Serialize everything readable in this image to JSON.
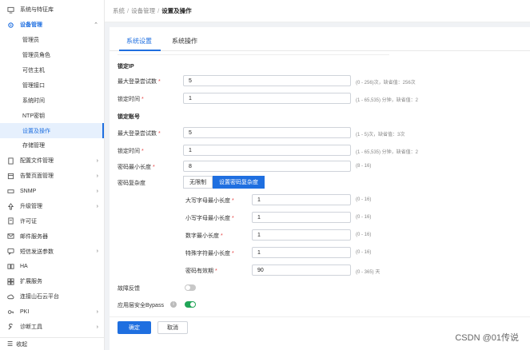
{
  "breadcrumb": [
    "系统",
    "设备管理",
    "设置及操作"
  ],
  "sidebar": {
    "items": [
      {
        "label": "系统与特征库",
        "icon": "monitor-icon"
      },
      {
        "label": "设备管理",
        "icon": "gear-icon"
      },
      {
        "label": "管理员"
      },
      {
        "label": "管理员角色"
      },
      {
        "label": "可信主机"
      },
      {
        "label": "管理接口"
      },
      {
        "label": "系统时间"
      },
      {
        "label": "NTP密钥"
      },
      {
        "label": "设置及操作"
      },
      {
        "label": "存储管理"
      },
      {
        "label": "配置文件管理",
        "icon": "file-icon"
      },
      {
        "label": "告警页面管理",
        "icon": "alarm-page-icon"
      },
      {
        "label": "SNMP",
        "icon": "snmp-icon"
      },
      {
        "label": "升级管理",
        "icon": "upgrade-icon"
      },
      {
        "label": "许可证",
        "icon": "license-icon"
      },
      {
        "label": "邮件服务器",
        "icon": "mail-icon"
      },
      {
        "label": "短信发送参数",
        "icon": "sms-icon"
      },
      {
        "label": "HA",
        "icon": "ha-icon"
      },
      {
        "label": "扩展服务",
        "icon": "extension-icon"
      },
      {
        "label": "连接山石云平台",
        "icon": "cloud-icon"
      },
      {
        "label": "PKI",
        "icon": "key-icon"
      },
      {
        "label": "诊断工具",
        "icon": "tool-icon"
      }
    ],
    "collapse_label": "收起"
  },
  "tabs": [
    "系统设置",
    "系统操作"
  ],
  "lock_ip": {
    "title": "锁定IP",
    "max_login_label": "最大登录尝试数",
    "max_login_value": "5",
    "max_login_hint": "(0 - 256)次，缺省值：256次",
    "lock_time_label": "锁定时间",
    "lock_time_value": "1",
    "lock_time_hint": "(1 - 65,535) 分钟，缺省值：2"
  },
  "lock_account": {
    "title": "锁定账号",
    "max_login_label": "最大登录尝试数",
    "max_login_value": "5",
    "max_login_hint": "(1 - 5)次，缺省值：3次",
    "lock_time_label": "锁定时间",
    "lock_time_value": "1",
    "lock_time_hint": "(1 - 65,535) 分钟，缺省值：2"
  },
  "password": {
    "min_len_label": "密码最小长度",
    "min_len_value": "8",
    "min_len_hint": "(8 - 16)",
    "complexity_label": "密码复杂度",
    "complexity_options": [
      "无限制",
      "设置密码复杂度"
    ],
    "upper_label": "大写字母最小长度",
    "upper_value": "1",
    "upper_hint": "(0 - 16)",
    "lower_label": "小写字母最小长度",
    "lower_value": "1",
    "lower_hint": "(0 - 16)",
    "digit_label": "数字最小长度",
    "digit_value": "1",
    "digit_hint": "(0 - 16)",
    "special_label": "特殊字符最小长度",
    "special_value": "1",
    "special_hint": "(0 - 16)",
    "expire_label": "密码有效期",
    "expire_value": "90",
    "expire_hint": "(0 - 365) 天"
  },
  "fault_feedback_label": "故障反馈",
  "fault_feedback_on": false,
  "bypass_label": "应用层安全Bypass",
  "bypass_on": true,
  "buttons": {
    "ok": "确定",
    "cancel": "取消"
  },
  "watermark": "CSDN @01传说",
  "colors": {
    "accent": "#1f6fe0",
    "toggle_on": "#21a557",
    "required": "#e64545"
  }
}
